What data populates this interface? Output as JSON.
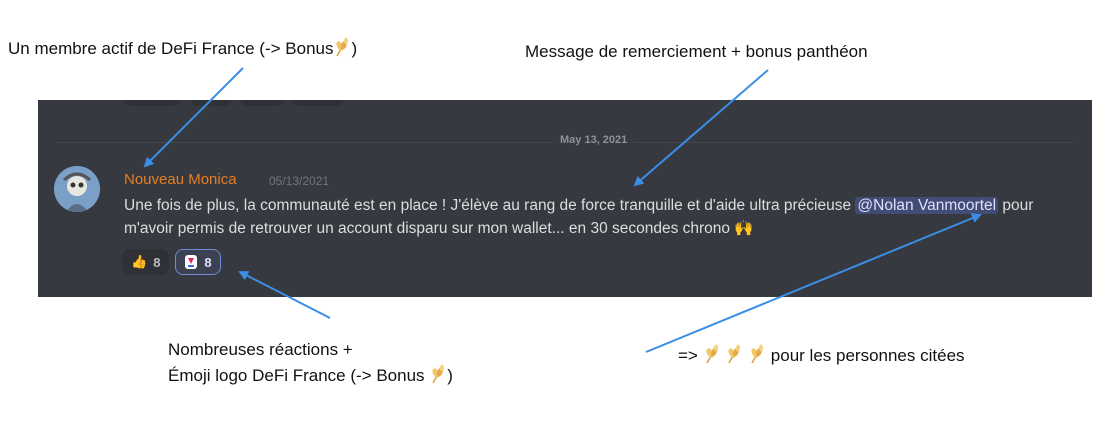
{
  "annotations": {
    "top_left_prefix": "Un membre actif de DeFi France (-> Bonus",
    "top_left_suffix": ")",
    "top_right": "Message de remerciement + bonus panthéon",
    "bottom_left_line1": "Nombreuses réactions +",
    "bottom_left_line2_prefix": "Émoji logo DeFi France (-> Bonus",
    "bottom_left_line2_suffix": ")",
    "bottom_right_prefix": "=>",
    "bottom_right_suffix": "pour les personnes citées"
  },
  "chat": {
    "date_divider": "May 13, 2021",
    "username": "Nouveau Monica",
    "timestamp": "05/13/2021",
    "message_part1": "Une fois de plus, la communauté est en place ! J'élève au rang de force tranquille et d'aide ultra précieuse ",
    "mention": "@Nolan Vanmoortel",
    "message_part2": " pour m'avoir permis de retrouver un account disparu sur mon wallet... en 30 secondes chrono ",
    "message_emoji": "🙌",
    "reactions": [
      {
        "emoji": "👍",
        "count": "8"
      },
      {
        "emoji": "defi-france-logo",
        "count": "8"
      }
    ]
  },
  "colors": {
    "panel_bg": "#36393f",
    "username": "#e67e22",
    "mention_bg": "#414c77",
    "arrow": "#3a8ee6",
    "wheat": "#f0c060"
  },
  "icons": [
    "wheat-icon",
    "thumbs-up-icon",
    "raised-hands-icon",
    "defi-france-logo-icon",
    "avatar"
  ]
}
